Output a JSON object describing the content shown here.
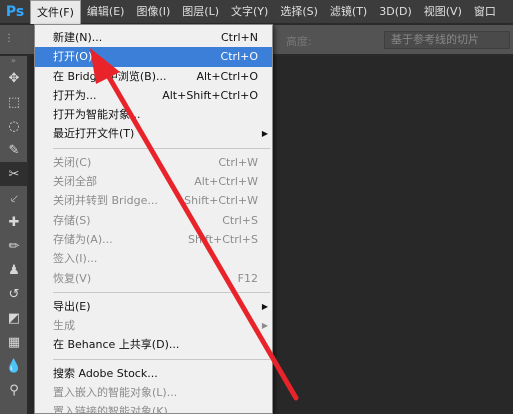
{
  "app": {
    "logo": "Ps"
  },
  "menubar": [
    {
      "label": "文件(F)",
      "active": true
    },
    {
      "label": "编辑(E)"
    },
    {
      "label": "图像(I)"
    },
    {
      "label": "图层(L)"
    },
    {
      "label": "文字(Y)"
    },
    {
      "label": "选择(S)"
    },
    {
      "label": "滤镜(T)"
    },
    {
      "label": "3D(D)"
    },
    {
      "label": "视图(V)"
    },
    {
      "label": "窗口"
    }
  ],
  "options_bar": {
    "height_label": "高度:",
    "slice_button": "基于参考线的切片"
  },
  "file_menu": {
    "new": {
      "label": "新建(N)...",
      "shortcut": "Ctrl+N"
    },
    "open": {
      "label": "打开(O)...",
      "shortcut": "Ctrl+O"
    },
    "browse_bridge": {
      "label": "在 Bridge 中浏览(B)...",
      "shortcut": "Alt+Ctrl+O"
    },
    "open_as": {
      "label": "打开为...",
      "shortcut": "Alt+Shift+Ctrl+O"
    },
    "open_smart": {
      "label": "打开为智能对象..."
    },
    "recent": {
      "label": "最近打开文件(T)"
    },
    "close": {
      "label": "关闭(C)",
      "shortcut": "Ctrl+W"
    },
    "close_all": {
      "label": "关闭全部",
      "shortcut": "Alt+Ctrl+W"
    },
    "close_bridge": {
      "label": "关闭并转到 Bridge...",
      "shortcut": "Shift+Ctrl+W"
    },
    "save": {
      "label": "存储(S)",
      "shortcut": "Ctrl+S"
    },
    "save_as": {
      "label": "存储为(A)...",
      "shortcut": "Shift+Ctrl+S"
    },
    "checkin": {
      "label": "签入(I)..."
    },
    "revert": {
      "label": "恢复(V)",
      "shortcut": "F12"
    },
    "export": {
      "label": "导出(E)"
    },
    "generate": {
      "label": "生成"
    },
    "behance": {
      "label": "在 Behance 上共享(D)..."
    },
    "adobe_stock": {
      "label": "搜索 Adobe Stock..."
    },
    "place_embedded": {
      "label": "置入嵌入的智能对象(L)..."
    },
    "place_linked": {
      "label": "置入链接的智能对象(K)..."
    }
  },
  "colors": {
    "accent": "#3b7fd9",
    "arrow": "#e8232a",
    "menubar": "#3c3c3c",
    "panel": "#535353"
  }
}
